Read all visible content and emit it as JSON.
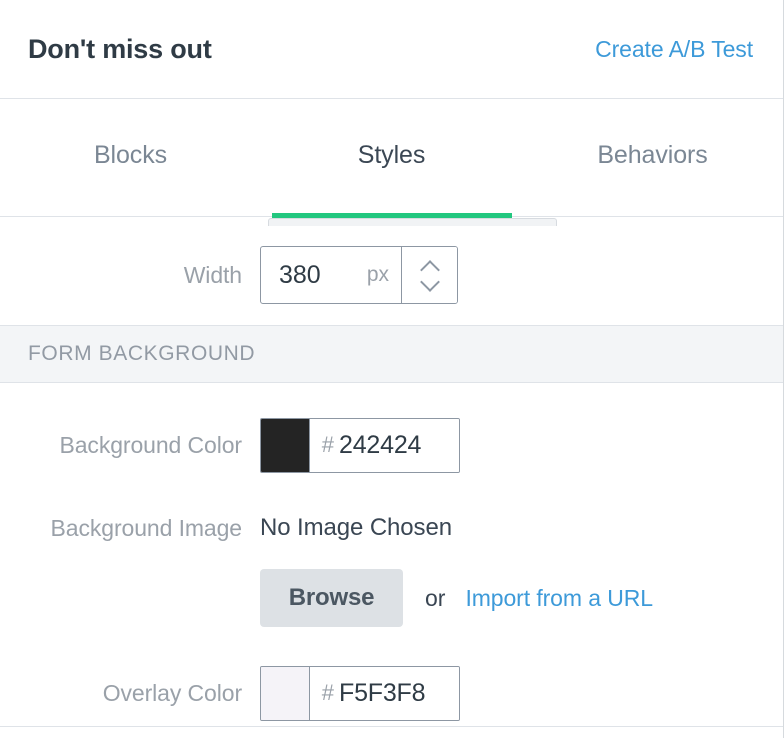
{
  "header": {
    "title": "Don't miss out",
    "ab_test_link": "Create A/B Test"
  },
  "tabs": [
    {
      "label": "Blocks",
      "active": false
    },
    {
      "label": "Styles",
      "active": true
    },
    {
      "label": "Behaviors",
      "active": false
    }
  ],
  "width_field": {
    "label": "Width",
    "value": "380",
    "unit": "px",
    "stepper_up_icon": "chevron-up-icon",
    "stepper_down_icon": "chevron-down-icon"
  },
  "form_background": {
    "section_title": "FORM BACKGROUND",
    "background_color": {
      "label": "Background Color",
      "hex_sign": "#",
      "hex_value": "242424",
      "swatch_color": "#242424"
    },
    "background_image": {
      "label": "Background Image",
      "status": "No Image Chosen",
      "browse_label": "Browse",
      "or_label": "or",
      "import_url_label": "Import from a URL"
    },
    "overlay_color": {
      "label": "Overlay Color",
      "hex_sign": "#",
      "hex_value": "F5F3F8",
      "swatch_color": "#F5F3F8"
    }
  },
  "theme": {
    "accent_green": "#22C77F",
    "link_blue": "#3D9AD9",
    "label_gray": "#9AA1A9",
    "text_dark": "#2F3B45",
    "section_bg": "#F3F5F7",
    "border_gray": "#DFE3E8"
  }
}
